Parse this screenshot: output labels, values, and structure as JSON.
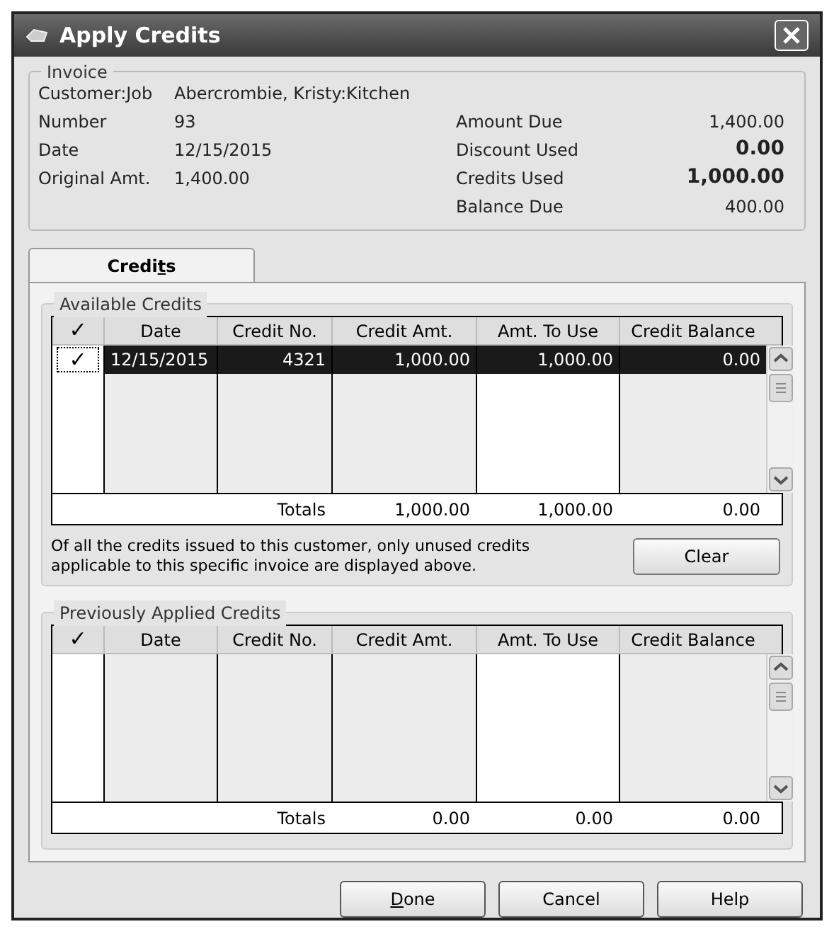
{
  "window": {
    "title": "Apply Credits"
  },
  "invoice": {
    "legend": "Invoice",
    "left": [
      {
        "label": "Customer:Job",
        "value": "Abercrombie, Kristy:Kitchen"
      },
      {
        "label": "Number",
        "value": "93"
      },
      {
        "label": "Date",
        "value": "12/15/2015"
      },
      {
        "label": "Original Amt.",
        "value": "1,400.00"
      }
    ],
    "right": [
      {
        "label": "Amount Due",
        "value": "1,400.00",
        "bold": false
      },
      {
        "label": "Discount Used",
        "value": "0.00",
        "bold": true
      },
      {
        "label": "Credits Used",
        "value": "1,000.00",
        "bold": true
      },
      {
        "label": "Balance Due",
        "value": "400.00",
        "bold": false
      }
    ]
  },
  "tabs": [
    {
      "before": "Credi",
      "mnemonic": "t",
      "after": "s",
      "selected": true
    }
  ],
  "available_credits": {
    "legend": "Available Credits",
    "columns": [
      "✓",
      "Date",
      "Credit No.",
      "Credit Amt.",
      "Amt. To Use",
      "Credit Balance"
    ],
    "rows": [
      {
        "checked": true,
        "selected": true,
        "cells": [
          "✓",
          "12/15/2015",
          "4321",
          "1,000.00",
          "1,000.00",
          "0.00"
        ]
      }
    ],
    "totals": {
      "label": "Totals",
      "values": [
        "1,000.00",
        "1,000.00",
        "0.00"
      ]
    },
    "note": "Of all the credits issued to this customer, only unused credits applicable to this specific invoice are displayed above.",
    "button": "Clear"
  },
  "previously_applied_credits": {
    "legend": "Previously Applied Credits",
    "columns": [
      "✓",
      "Date",
      "Credit No.",
      "Credit Amt.",
      "Amt. To Use",
      "Credit Balance"
    ],
    "totals": {
      "label": "Totals",
      "values": [
        "0.00",
        "0.00",
        "0.00"
      ]
    }
  },
  "buttons": [
    {
      "mnemonic": "D",
      "after": "one"
    },
    {
      "before": "Cancel"
    },
    {
      "before": "Help"
    }
  ]
}
